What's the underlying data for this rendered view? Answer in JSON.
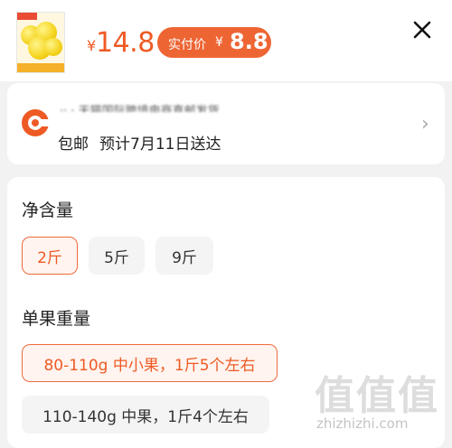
{
  "header": {
    "currency_symbol": "¥",
    "price": "14.8",
    "actual_label": "实付价",
    "actual_symbol": "¥",
    "actual_price": "8.8",
    "close_icon": "close-icon"
  },
  "shipping": {
    "redacted_line": "·· · 天猫国际跨境电商直邮发货",
    "free_shipping": "包邮",
    "estimate": "预计7月11日送达",
    "icon": "shipping-logo-icon",
    "arrow_icon": "chevron-right-icon"
  },
  "specs": {
    "net_weight_title": "净含量",
    "net_weight_options": [
      {
        "label": "2斤",
        "selected": true
      },
      {
        "label": "5斤",
        "selected": false
      },
      {
        "label": "9斤",
        "selected": false
      }
    ],
    "fruit_weight_title": "单果重量",
    "fruit_weight_options": [
      {
        "label": "80-110g 中小果，1斤5个左右",
        "selected": true
      },
      {
        "label": "110-140g 中果，1斤4个左右",
        "selected": false
      }
    ]
  },
  "watermark": {
    "glyphs": "值值值",
    "url": "zhizhizhi.com"
  },
  "colors": {
    "accent": "#ee5a24",
    "badge": "#ee6534",
    "chip_selected_bg": "#fff4ef"
  }
}
